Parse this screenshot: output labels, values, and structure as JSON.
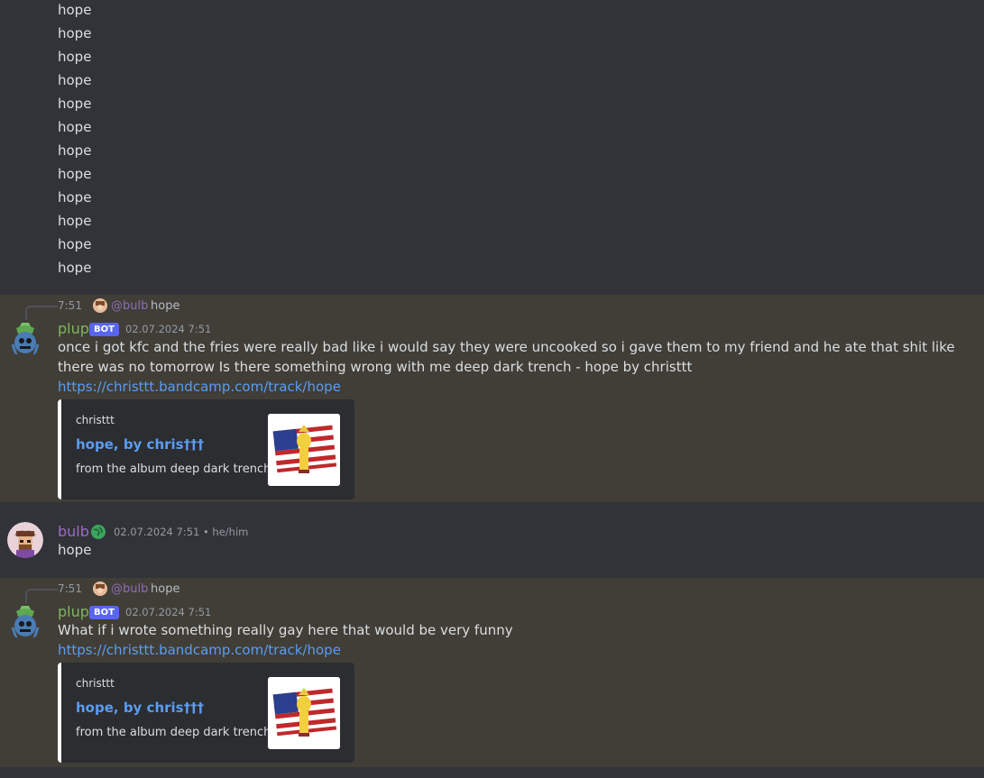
{
  "earlier_messages": [
    "hope",
    "hope",
    "hope",
    "hope",
    "hope",
    "hope",
    "hope",
    "hope",
    "hope",
    "hope",
    "hope",
    "hope"
  ],
  "messages": [
    {
      "reply": {
        "time": "7:51",
        "user": "@bulb",
        "text": "hope"
      },
      "author": "plup",
      "author_color": "#7fb55c",
      "badge": "BOT",
      "timestamp": "02.07.2024 7:51",
      "content": "once i got kfc and the fries were really bad like i would say they were uncooked so i gave them to my friend and he ate that shit like there was no tomorrow Is there something wrong with me deep dark trench - hope by christtt",
      "link": "https://christtt.bandcamp.com/track/hope",
      "embed": {
        "author": "christtt",
        "title": "hope, by chris†††",
        "description": "from the album deep dark trench"
      }
    },
    {
      "author": "bulb",
      "author_color": "#9b6cc7",
      "timestamp": "02.07.2024 7:51 • he/him",
      "content": "hope"
    },
    {
      "reply": {
        "time": "7:51",
        "user": "@bulb",
        "text": "hope"
      },
      "author": "plup",
      "author_color": "#7fb55c",
      "badge": "BOT",
      "timestamp": "02.07.2024 7:51",
      "content": "What if i wrote something really gay here that would be very funny",
      "link": "https://christtt.bandcamp.com/track/hope",
      "embed": {
        "author": "christtt",
        "title": "hope, by chris†††",
        "description": "from the album deep dark trench"
      }
    }
  ],
  "colors": {
    "background": "#313338",
    "highlight": "#403e37",
    "link": "#5b9cf2",
    "bot_badge": "#5865f2"
  }
}
